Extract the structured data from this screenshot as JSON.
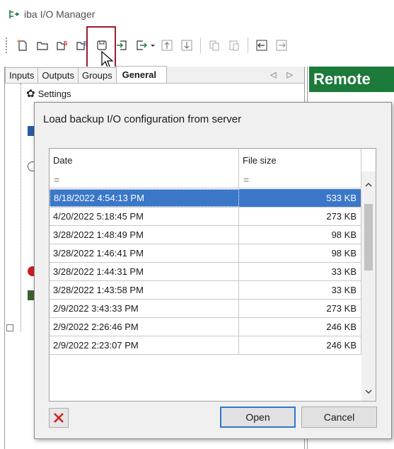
{
  "window": {
    "title": "iba I/O Manager"
  },
  "toolbar": {
    "icons": [
      "new-config-icon",
      "open-config-icon",
      "load-from-server-icon",
      "load-backup-icon",
      "save-icon",
      "import-icon",
      "export-icon",
      "move-up-icon",
      "move-down-icon",
      "copy-icon",
      "paste-icon",
      "collapse-icon",
      "expand-icon"
    ],
    "highlight_color": "#9b1b2c"
  },
  "left_panel": {
    "tabs": [
      {
        "label": "Inputs"
      },
      {
        "label": "Outputs"
      },
      {
        "label": "Groups"
      },
      {
        "label": "General",
        "active": true
      }
    ],
    "tab_arrows": "◁ ▷",
    "tree": {
      "settings_label": "Settings"
    }
  },
  "right_panel": {
    "header": "Remote",
    "header_color": "#1c7a3a"
  },
  "dialog": {
    "title": "Load backup I/O configuration from server",
    "columns": {
      "date": "Date",
      "size": "File size"
    },
    "filter": {
      "date": "=",
      "size": "="
    },
    "rows": [
      {
        "date": "8/18/2022 4:54:13 PM",
        "size": "533 KB",
        "selected": true
      },
      {
        "date": "4/20/2022 5:18:45 PM",
        "size": "273 KB"
      },
      {
        "date": "3/28/2022 1:48:49 PM",
        "size": "98 KB"
      },
      {
        "date": "3/28/2022 1:46:41 PM",
        "size": "98 KB"
      },
      {
        "date": "3/28/2022 1:44:31 PM",
        "size": "33 KB"
      },
      {
        "date": "3/28/2022 1:43:58 PM",
        "size": "33 KB"
      },
      {
        "date": "2/9/2022 3:43:33 PM",
        "size": "273 KB"
      },
      {
        "date": "2/9/2022 2:26:46 PM",
        "size": "246 KB"
      },
      {
        "date": "2/9/2022 2:23:07 PM",
        "size": "246 KB"
      }
    ],
    "buttons": {
      "open": "Open",
      "cancel": "Cancel"
    },
    "selection_color": "#3a77c8",
    "delete_icon_color": "#d32020"
  }
}
